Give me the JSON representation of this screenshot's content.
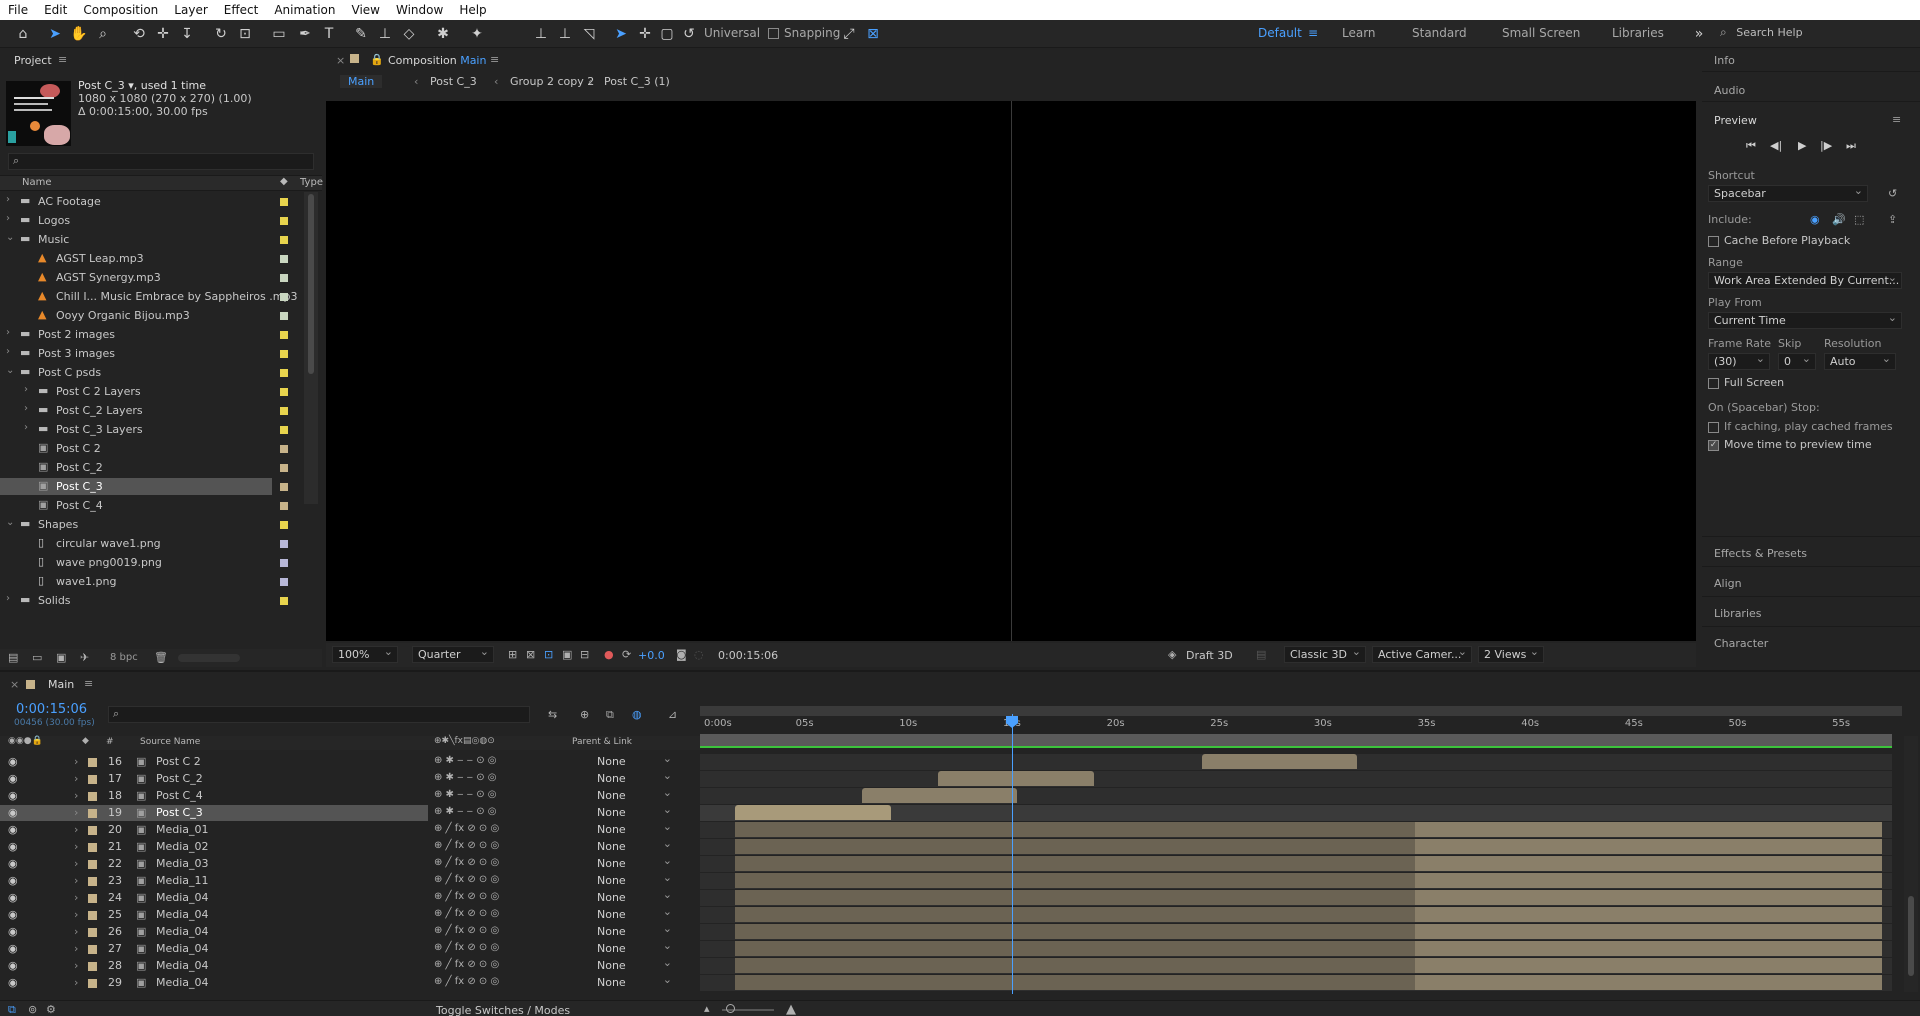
{
  "menu": [
    "File",
    "Edit",
    "Composition",
    "Layer",
    "Effect",
    "Animation",
    "View",
    "Window",
    "Help"
  ],
  "toolbar": {
    "universal_label": "Universal",
    "snapping_label": "Snapping",
    "workspaces": [
      "Default",
      "Learn",
      "Standard",
      "Small Screen",
      "Libraries"
    ],
    "active_workspace": "Default",
    "search_help": "Search Help"
  },
  "project": {
    "tab_label": "Project",
    "item_name": "Post C_3",
    "item_used": ", used 1 time",
    "item_dims": "1080 x 1080  (270 x 270) (1.00)",
    "item_duration": "Δ 0:00:15:00, 30.00 fps",
    "col_name": "Name",
    "col_type": "Type",
    "bpc": "8 bpc",
    "items": [
      {
        "label": "AC Footage",
        "kind": "folder",
        "indent": 0,
        "expanded": false,
        "color": "#e8d44d"
      },
      {
        "label": "Logos",
        "kind": "folder",
        "indent": 0,
        "expanded": false,
        "color": "#e8d44d"
      },
      {
        "label": "Music",
        "kind": "folder",
        "indent": 0,
        "expanded": true,
        "color": "#e8d44d"
      },
      {
        "label": "AGST  Leap.mp3",
        "kind": "audio",
        "indent": 1,
        "color": "#c9d6c0"
      },
      {
        "label": "AGST  Synergy.mp3",
        "kind": "audio",
        "indent": 1,
        "color": "#c9d6c0"
      },
      {
        "label": "Chill I... Music Embrace by Sappheiros .mp3",
        "kind": "audio",
        "indent": 1,
        "color": "#c9d6c0"
      },
      {
        "label": "Ooyy  Organic Bijou.mp3",
        "kind": "audio",
        "indent": 1,
        "color": "#c9d6c0"
      },
      {
        "label": "Post 2 images",
        "kind": "folder",
        "indent": 0,
        "expanded": false,
        "color": "#e8d44d"
      },
      {
        "label": "Post 3 images",
        "kind": "folder",
        "indent": 0,
        "expanded": false,
        "color": "#e8d44d"
      },
      {
        "label": "Post C psds",
        "kind": "folder",
        "indent": 0,
        "expanded": true,
        "color": "#e8d44d"
      },
      {
        "label": "Post C 2 Layers",
        "kind": "folder",
        "indent": 1,
        "expanded": false,
        "color": "#e8d44d"
      },
      {
        "label": "Post C_2 Layers",
        "kind": "folder",
        "indent": 1,
        "expanded": false,
        "color": "#e8d44d"
      },
      {
        "label": "Post C_3 Layers",
        "kind": "folder",
        "indent": 1,
        "expanded": false,
        "color": "#e8d44d"
      },
      {
        "label": "Post C 2",
        "kind": "comp",
        "indent": 1,
        "color": "#c7b38a"
      },
      {
        "label": "Post C_2",
        "kind": "comp",
        "indent": 1,
        "color": "#c7b38a"
      },
      {
        "label": "Post C_3",
        "kind": "comp",
        "indent": 1,
        "color": "#c7b38a",
        "selected": true
      },
      {
        "label": "Post C_4",
        "kind": "comp",
        "indent": 1,
        "color": "#c7b38a"
      },
      {
        "label": "Shapes",
        "kind": "folder",
        "indent": 0,
        "expanded": true,
        "color": "#e8d44d"
      },
      {
        "label": "circular wave1.png",
        "kind": "image",
        "indent": 1,
        "color": "#b8b8d8"
      },
      {
        "label": "wave png0019.png",
        "kind": "image",
        "indent": 1,
        "color": "#b8b8d8"
      },
      {
        "label": "wave1.png",
        "kind": "image",
        "indent": 1,
        "color": "#b8b8d8"
      },
      {
        "label": "Solids",
        "kind": "folder",
        "indent": 0,
        "expanded": false,
        "color": "#e8d44d"
      }
    ]
  },
  "composition": {
    "tab_prefix": "Composition",
    "tab_name": "Main",
    "breadcrumbs": [
      "Main",
      "Post C_3",
      "Group 2 copy 2",
      "Post C_3 (1)"
    ],
    "zoom": "100%",
    "resolution": "Quarter",
    "exposure": "+0.0",
    "timecode": "0:00:15:06",
    "draft3d": "Draft 3D",
    "renderer": "Classic 3D",
    "camera": "Active Camer...",
    "views": "2 Views"
  },
  "right_panel": {
    "info": "Info",
    "audio": "Audio",
    "preview": "Preview",
    "shortcut_label": "Shortcut",
    "shortcut_value": "Spacebar",
    "include_label": "Include:",
    "cache_label": "Cache Before Playback",
    "range_label": "Range",
    "range_value": "Work Area Extended By Current...",
    "play_from_label": "Play From",
    "play_from_value": "Current Time",
    "frame_rate_label": "Frame Rate",
    "frame_rate_value": "(30)",
    "skip_label": "Skip",
    "skip_value": "0",
    "resolution_label": "Resolution",
    "resolution_value": "Auto",
    "full_screen_label": "Full Screen",
    "stop_label": "On (Spacebar) Stop:",
    "if_caching_label": "If caching, play cached frames",
    "move_time_label": "Move time to preview time",
    "effects_presets": "Effects & Presets",
    "align": "Align",
    "libraries": "Libraries",
    "character": "Character"
  },
  "timeline": {
    "tab_name": "Main",
    "timecode": "0:00:15:06",
    "frame_info": "00456 (30.00 fps)",
    "source_name_header": "Source Name",
    "parent_header": "Parent & Link",
    "toggle_label": "Toggle Switches / Modes",
    "ruler": [
      "0:00s",
      "05s",
      "10s",
      "15s",
      "20s",
      "25s",
      "30s",
      "35s",
      "40s",
      "45s",
      "50s",
      "55s"
    ],
    "layers": [
      {
        "num": "16",
        "name": "Post C 2",
        "parent": "None",
        "start": 22.5,
        "end": 30.0,
        "type": "comp"
      },
      {
        "num": "17",
        "name": "Post C_2",
        "parent": "None",
        "start": 9.8,
        "end": 17.3,
        "type": "comp"
      },
      {
        "num": "18",
        "name": "Post C_4",
        "parent": "None",
        "start": 6.1,
        "end": 13.6,
        "type": "comp"
      },
      {
        "num": "19",
        "name": "Post C_3",
        "parent": "None",
        "start": 0.0,
        "end": 7.5,
        "type": "comp",
        "selected": true
      },
      {
        "num": "20",
        "name": "Media_01",
        "parent": "None",
        "type": "media"
      },
      {
        "num": "21",
        "name": "Media_02",
        "parent": "None",
        "type": "media"
      },
      {
        "num": "22",
        "name": "Media_03",
        "parent": "None",
        "type": "media"
      },
      {
        "num": "23",
        "name": "Media_11",
        "parent": "None",
        "type": "media"
      },
      {
        "num": "24",
        "name": "Media_04",
        "parent": "None",
        "type": "media"
      },
      {
        "num": "25",
        "name": "Media_04",
        "parent": "None",
        "type": "media"
      },
      {
        "num": "26",
        "name": "Media_04",
        "parent": "None",
        "type": "media"
      },
      {
        "num": "27",
        "name": "Media_04",
        "parent": "None",
        "type": "media"
      },
      {
        "num": "28",
        "name": "Media_04",
        "parent": "None",
        "type": "media"
      },
      {
        "num": "29",
        "name": "Media_04",
        "parent": "None",
        "type": "media"
      }
    ]
  }
}
